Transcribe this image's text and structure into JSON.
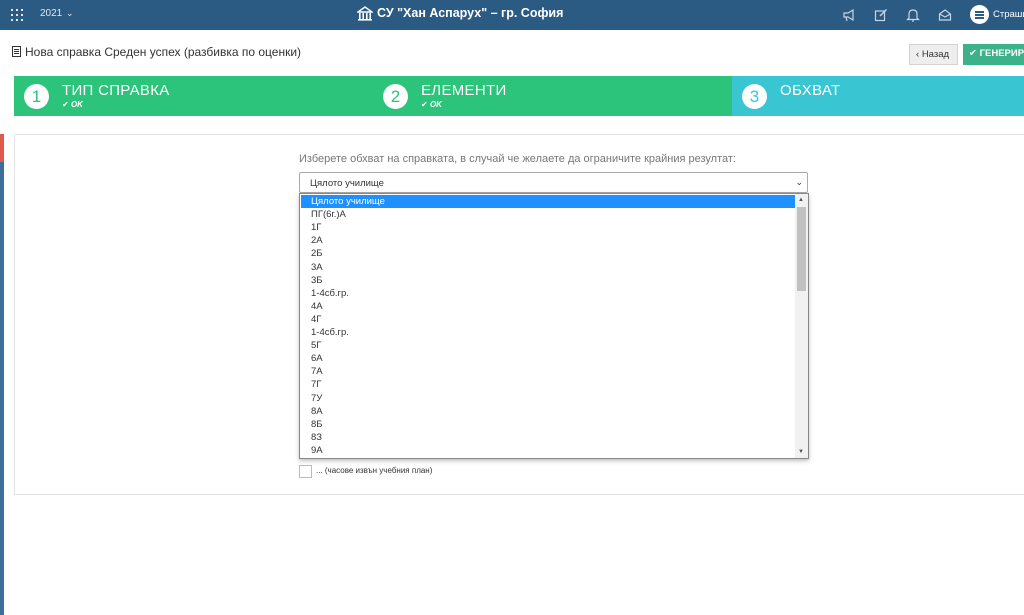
{
  "topbar": {
    "year": "2021",
    "year_icon": "chevron-down-icon",
    "school_name": "СУ \"Хан Аспарух\" – гр. София",
    "school_icon": "school-building-icon",
    "icons": [
      "megaphone-icon",
      "edit-icon",
      "bell-icon",
      "envelope-icon"
    ],
    "user_name": "Страши"
  },
  "header": {
    "title": "Нова справка Среден успех (разбивка по оценки)",
    "back_label": "Назад",
    "generate_label": "ГЕНЕРИР"
  },
  "wizard": {
    "steps": [
      {
        "number": "1",
        "title": "ТИП СПРАВКА",
        "status": "OK"
      },
      {
        "number": "2",
        "title": "ЕЛЕМЕНТИ",
        "status": "OK"
      },
      {
        "number": "3",
        "title": "ОБХВАТ",
        "status": ""
      }
    ]
  },
  "scope": {
    "prompt": "Изберете обхват на справката, в случай че желаете да ограничите крайния резултат:",
    "selected": "Цялото училище",
    "options": [
      "Цялото училище",
      "ПГ(6г.)А",
      "1Г",
      "2А",
      "2Б",
      "3А",
      "3Б",
      "1-4сб.гр.",
      "4А",
      "4Г",
      "1-4сб.гр.",
      "5Г",
      "6А",
      "7А",
      "7Г",
      "7У",
      "8А",
      "8Б",
      "8З",
      "9А"
    ],
    "checkbox_label": "... (часове извън учебния план)"
  },
  "colors": {
    "topbar": "#2b5a83",
    "step_done": "#2cc37a",
    "step_current": "#39c6d2",
    "selection": "#1e90ff",
    "generate_button": "#3cb28a"
  }
}
